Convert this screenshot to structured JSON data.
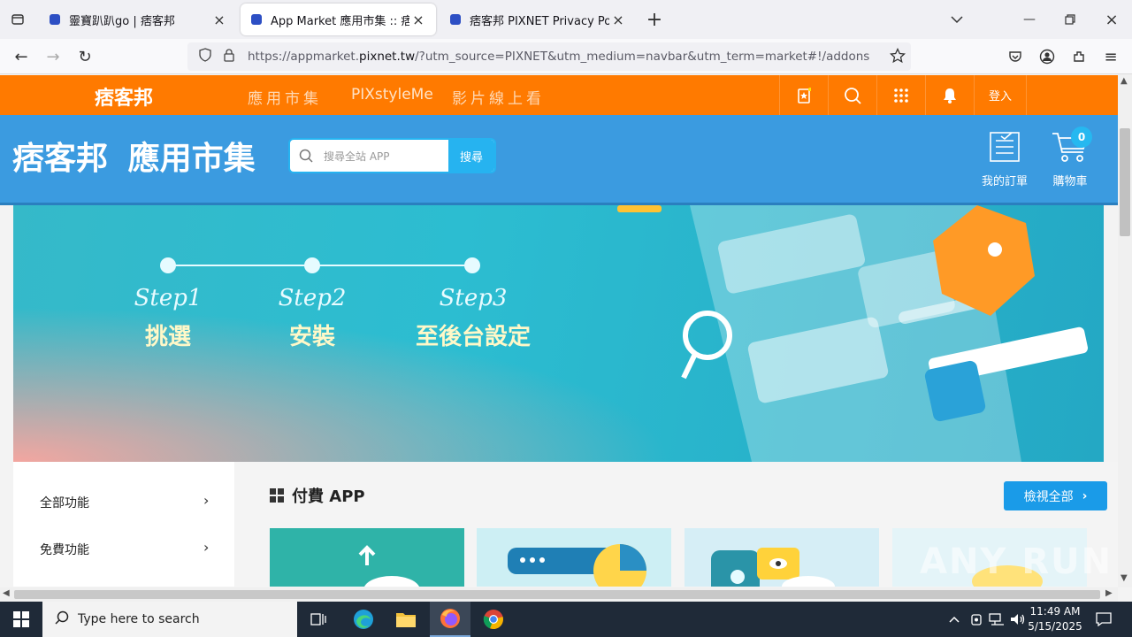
{
  "browser": {
    "tabs": [
      {
        "title": "靈寶趴趴go | 痞客邦",
        "active": false
      },
      {
        "title": "App Market 應用市集 :: 痞客邦",
        "active": true
      },
      {
        "title": "痞客邦 PIXNET Privacy Policy",
        "active": false
      }
    ],
    "url_prefix": "https://appmarket.",
    "url_host": "pixnet.tw",
    "url_suffix": "/?utm_source=PIXNET&utm_medium=navbar&utm_term=market#!/addons"
  },
  "pixbar": {
    "logo": "痞客邦",
    "nav": [
      "應用市集",
      "PIXstyleMe",
      "影片線上看"
    ],
    "login": "登入"
  },
  "header": {
    "brand_logo": "痞客邦",
    "brand_title": "應用市集",
    "search_placeholder": "搜尋全站 APP",
    "search_button": "搜尋",
    "orders_label": "我的訂單",
    "cart_label": "購物車",
    "cart_count": "0"
  },
  "hero": {
    "steps": [
      {
        "en": "Step1",
        "zh": "挑選"
      },
      {
        "en": "Step2",
        "zh": "安裝"
      },
      {
        "en": "Step3",
        "zh": "至後台設定"
      }
    ]
  },
  "sidebar": {
    "items": [
      {
        "label": "全部功能"
      },
      {
        "label": "免費功能"
      }
    ]
  },
  "main": {
    "section_title": "付費 APP",
    "view_all": "檢視全部"
  },
  "taskbar": {
    "search_placeholder": "Type here to search",
    "time": "11:49 AM",
    "date": "5/15/2025"
  },
  "watermark": "ANY RUN",
  "colors": {
    "pixnet_orange": "#ff7a00",
    "header_blue": "#3b9be0",
    "accent_cyan": "#26b3f0",
    "view_all_blue": "#1a9be8"
  }
}
